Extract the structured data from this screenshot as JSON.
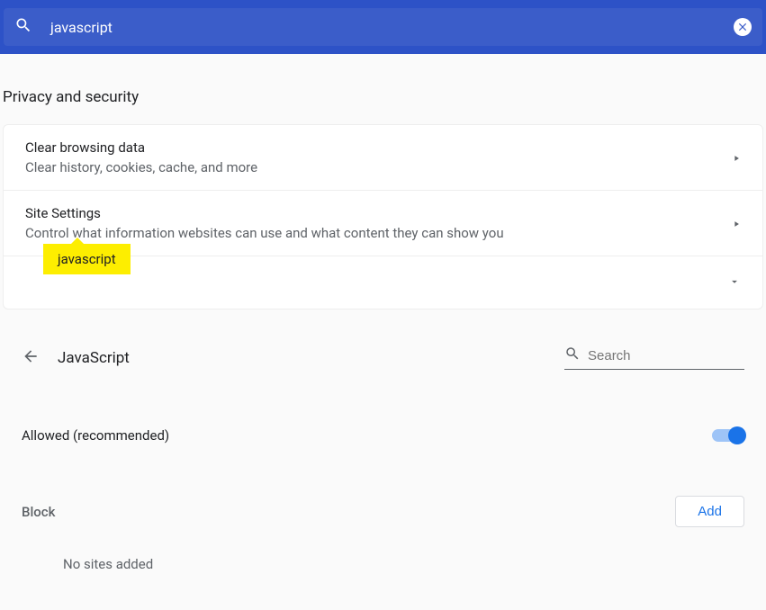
{
  "search": {
    "query": "javascript",
    "placeholder": "Search"
  },
  "section": {
    "title": "Privacy and security"
  },
  "rows": [
    {
      "title": "Clear browsing data",
      "sub": "Clear history, cookies, cache, and more"
    },
    {
      "title": "Site Settings",
      "sub": "Control what information websites can use and what content they can show you"
    }
  ],
  "more": {
    "tooltip": "javascript"
  },
  "detail": {
    "title": "JavaScript",
    "search_placeholder": "Search",
    "allowed_label": "Allowed (recommended)",
    "block_label": "Block",
    "add_button": "Add",
    "no_sites": "No sites added"
  }
}
